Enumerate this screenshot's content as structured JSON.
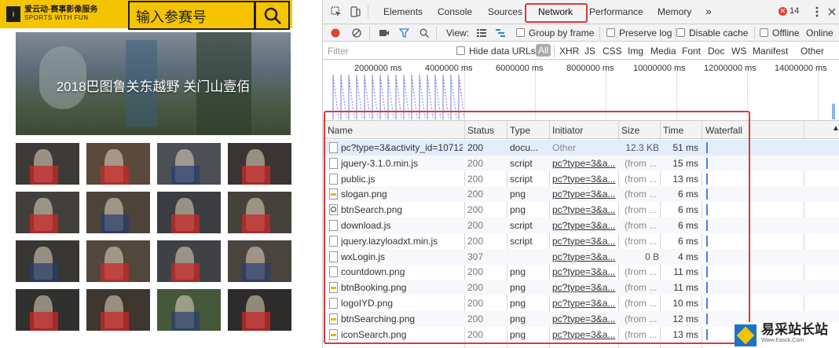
{
  "site": {
    "logo_cn": "爱云动·赛事影像服务",
    "logo_en": "SPORTS WITH FUN",
    "search_placeholder": "输入参赛号",
    "banner_title": "2018巴图鲁关东越野 关门山壹佰",
    "thumb_colors": [
      "#3c3a36",
      "#5a4a3c",
      "#4c4f55",
      "#3a3532",
      "#42403c",
      "#4d433a",
      "#3b3d42",
      "#45413b",
      "#383632",
      "#52473d",
      "#3f4146",
      "#4a443e",
      "#30302e",
      "#3d3730",
      "#46583a",
      "#2e2c2a"
    ]
  },
  "devtools": {
    "tabs": [
      "Elements",
      "Console",
      "Sources",
      "Network",
      "Performance",
      "Memory"
    ],
    "more_tabs": "»",
    "error_count": "14",
    "toolbar": {
      "view_label": "View:",
      "group_by_frame": "Group by frame",
      "preserve_log": "Preserve log",
      "disable_cache": "Disable cache",
      "offline": "Offline",
      "online": "Online"
    },
    "filter": {
      "placeholder": "Filter",
      "hide_data_urls": "Hide data URLs",
      "types": [
        "All",
        "XHR",
        "JS",
        "CSS",
        "Img",
        "Media",
        "Font",
        "Doc",
        "WS",
        "Manifest",
        "Other"
      ]
    },
    "timeline_labels": [
      "2000000 ms",
      "4000000 ms",
      "6000000 ms",
      "8000000 ms",
      "10000000 ms",
      "12000000 ms",
      "14000000 ms"
    ],
    "columns": [
      "Name",
      "Status",
      "Type",
      "Initiator",
      "Size",
      "Time",
      "Waterfall"
    ],
    "requests": [
      {
        "name": "pc?type=3&activity_id=10712",
        "status": "200",
        "type": "docu...",
        "initiator": "Other",
        "size": "12.3 KB",
        "time": "51 ms",
        "icon": "doc"
      },
      {
        "name": "jquery-3.1.0.min.js",
        "status": "200",
        "type": "script",
        "initiator": "pc?type=3&a...",
        "size": "(from ...",
        "time": "15 ms",
        "icon": "doc"
      },
      {
        "name": "public.js",
        "status": "200",
        "type": "script",
        "initiator": "pc?type=3&a...",
        "size": "(from ...",
        "time": "13 ms",
        "icon": "doc"
      },
      {
        "name": "slogan.png",
        "status": "200",
        "type": "png",
        "initiator": "pc?type=3&a...",
        "size": "(from ...",
        "time": "6 ms",
        "icon": "img"
      },
      {
        "name": "btnSearch.png",
        "status": "200",
        "type": "png",
        "initiator": "pc?type=3&a...",
        "size": "(from ...",
        "time": "6 ms",
        "icon": "search"
      },
      {
        "name": "download.js",
        "status": "200",
        "type": "script",
        "initiator": "pc?type=3&a...",
        "size": "(from ...",
        "time": "6 ms",
        "icon": "doc"
      },
      {
        "name": "jquery.lazyloadxt.min.js",
        "status": "200",
        "type": "script",
        "initiator": "pc?type=3&a...",
        "size": "(from ...",
        "time": "6 ms",
        "icon": "doc"
      },
      {
        "name": "wxLogin.js",
        "status": "307",
        "type": "",
        "initiator": "pc?type=3&a...",
        "size": "0 B",
        "time": "4 ms",
        "icon": "doc"
      },
      {
        "name": "countdown.png",
        "status": "200",
        "type": "png",
        "initiator": "pc?type=3&a...",
        "size": "(from ...",
        "time": "11 ms",
        "icon": "doc"
      },
      {
        "name": "btnBooking.png",
        "status": "200",
        "type": "png",
        "initiator": "pc?type=3&a...",
        "size": "(from ...",
        "time": "11 ms",
        "icon": "img"
      },
      {
        "name": "logoIYD.png",
        "status": "200",
        "type": "png",
        "initiator": "pc?type=3&a...",
        "size": "(from ...",
        "time": "10 ms",
        "icon": "doc"
      },
      {
        "name": "btnSearching.png",
        "status": "200",
        "type": "png",
        "initiator": "pc?type=3&a...",
        "size": "(from ...",
        "time": "12 ms",
        "icon": "img"
      },
      {
        "name": "iconSearch.png",
        "status": "200",
        "type": "png",
        "initiator": "pc?type=3&a...",
        "size": "(from ...",
        "time": "13 ms",
        "icon": "img"
      }
    ],
    "highlight_color": "#d83a3a"
  },
  "watermark": {
    "cn": "易采站长站",
    "en": "Www.Easck.Com"
  }
}
